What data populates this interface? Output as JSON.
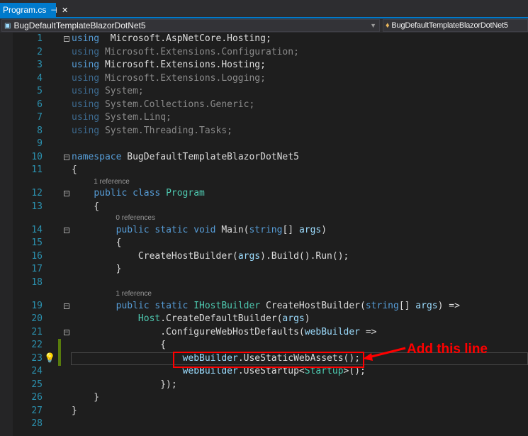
{
  "tab": {
    "title": "Program.cs",
    "pin_icon": "pin-icon",
    "close_icon": "close-icon"
  },
  "nav": {
    "project": "BugDefaultTemplateBlazorDotNet5",
    "type": "BugDefaultTemplateBlazorDotNet5"
  },
  "colors": {
    "keyword": "#569cd6",
    "type": "#4ec9b0",
    "parameter": "#9cdcfe",
    "text": "#dcdcdc",
    "line_number": "#2b91af",
    "accent": "#007acc",
    "annotation": "#ff0000"
  },
  "lines": [
    {
      "n": "1",
      "fold": "-",
      "tokens": [
        [
          "k",
          "using"
        ],
        [
          "",
          "  Microsoft.AspNetCore.Hosting;"
        ]
      ]
    },
    {
      "n": "2",
      "tokens": [
        [
          "dk",
          "using"
        ],
        [
          "d",
          " Microsoft.Extensions.Configuration;"
        ]
      ]
    },
    {
      "n": "3",
      "tokens": [
        [
          "k",
          "using"
        ],
        [
          "",
          " Microsoft.Extensions.Hosting;"
        ]
      ]
    },
    {
      "n": "4",
      "tokens": [
        [
          "dk",
          "using"
        ],
        [
          "d",
          " Microsoft.Extensions.Logging;"
        ]
      ]
    },
    {
      "n": "5",
      "tokens": [
        [
          "dk",
          "using"
        ],
        [
          "d",
          " System;"
        ]
      ]
    },
    {
      "n": "6",
      "tokens": [
        [
          "dk",
          "using"
        ],
        [
          "d",
          " System.Collections.Generic;"
        ]
      ]
    },
    {
      "n": "7",
      "tokens": [
        [
          "dk",
          "using"
        ],
        [
          "d",
          " System.Linq;"
        ]
      ]
    },
    {
      "n": "8",
      "tokens": [
        [
          "dk",
          "using"
        ],
        [
          "d",
          " System.Threading.Tasks;"
        ]
      ]
    },
    {
      "n": "9",
      "tokens": []
    },
    {
      "n": "10",
      "fold": "-",
      "tokens": [
        [
          "k",
          "namespace"
        ],
        [
          "",
          " BugDefaultTemplateBlazorDotNet5"
        ]
      ]
    },
    {
      "n": "11",
      "tokens": [
        [
          "",
          "{"
        ]
      ]
    },
    {
      "n": "12",
      "fold": "-",
      "lens": "1 reference",
      "indent": 4,
      "tokens": [
        [
          "",
          "    "
        ],
        [
          "k",
          "public class"
        ],
        [
          "",
          " "
        ],
        [
          "t",
          "Program"
        ]
      ]
    },
    {
      "n": "13",
      "tokens": [
        [
          "",
          "    {"
        ]
      ]
    },
    {
      "n": "14",
      "fold": "-",
      "lens": "0 references",
      "indent": 8,
      "tokens": [
        [
          "",
          "        "
        ],
        [
          "k",
          "public static void"
        ],
        [
          "",
          " Main("
        ],
        [
          "k",
          "string"
        ],
        [
          "",
          "[] "
        ],
        [
          "p",
          "args"
        ],
        [
          "",
          ")"
        ]
      ]
    },
    {
      "n": "15",
      "tokens": [
        [
          "",
          "        {"
        ]
      ]
    },
    {
      "n": "16",
      "tokens": [
        [
          "",
          "            CreateHostBuilder("
        ],
        [
          "p",
          "args"
        ],
        [
          "",
          ").Build().Run();"
        ]
      ]
    },
    {
      "n": "17",
      "tokens": [
        [
          "",
          "        }"
        ]
      ]
    },
    {
      "n": "18",
      "tokens": []
    },
    {
      "n": "19",
      "fold": "-",
      "lens": "1 reference",
      "indent": 8,
      "tokens": [
        [
          "",
          "        "
        ],
        [
          "k",
          "public static"
        ],
        [
          "",
          " "
        ],
        [
          "t",
          "IHostBuilder"
        ],
        [
          "",
          " CreateHostBuilder("
        ],
        [
          "k",
          "string"
        ],
        [
          "",
          "[] "
        ],
        [
          "p",
          "args"
        ],
        [
          "",
          ") =>"
        ]
      ]
    },
    {
      "n": "20",
      "tokens": [
        [
          "",
          "            "
        ],
        [
          "t",
          "Host"
        ],
        [
          "",
          ".CreateDefaultBuilder("
        ],
        [
          "p",
          "args"
        ],
        [
          "",
          ")"
        ]
      ]
    },
    {
      "n": "21",
      "fold": "-",
      "tokens": [
        [
          "",
          "                .ConfigureWebHostDefaults("
        ],
        [
          "p",
          "webBuilder"
        ],
        [
          "",
          " =>"
        ]
      ]
    },
    {
      "n": "22",
      "change": true,
      "tokens": [
        [
          "",
          "                {"
        ]
      ]
    },
    {
      "n": "23",
      "change": true,
      "current": true,
      "bulb": true,
      "tokens": [
        [
          "",
          "                    "
        ],
        [
          "p",
          "webBuilder"
        ],
        [
          "",
          ".UseStaticWebAssets();"
        ]
      ]
    },
    {
      "n": "24",
      "tokens": [
        [
          "",
          "                    "
        ],
        [
          "p",
          "webBuilder"
        ],
        [
          "",
          ".UseStartup<"
        ],
        [
          "t",
          "Startup"
        ],
        [
          "",
          ">();"
        ]
      ]
    },
    {
      "n": "25",
      "tokens": [
        [
          "",
          "                });"
        ]
      ]
    },
    {
      "n": "26",
      "tokens": [
        [
          "",
          "    }"
        ]
      ]
    },
    {
      "n": "27",
      "tokens": [
        [
          "",
          "}"
        ]
      ]
    },
    {
      "n": "28",
      "tokens": []
    }
  ],
  "annotation": {
    "text": "Add this line"
  }
}
